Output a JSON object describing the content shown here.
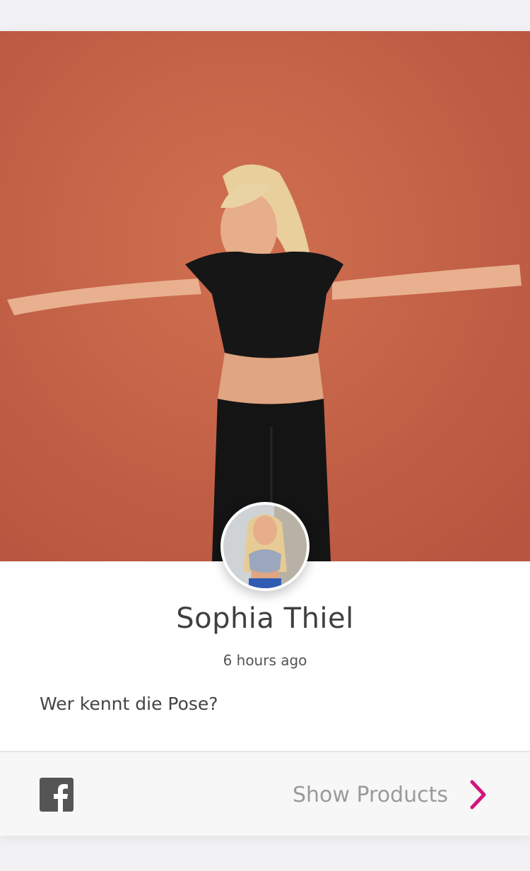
{
  "post": {
    "author": "Sophia Thiel",
    "time_ago": "6 hours ago",
    "caption": "Wer kennt die Pose?"
  },
  "footer": {
    "share_icon": "facebook-icon",
    "show_products_label": "Show Products",
    "chevron_icon": "chevron-right-icon"
  },
  "colors": {
    "hero_wall": "#c8654a",
    "accent": "#d4137f",
    "facebook_icon": "#555555"
  }
}
